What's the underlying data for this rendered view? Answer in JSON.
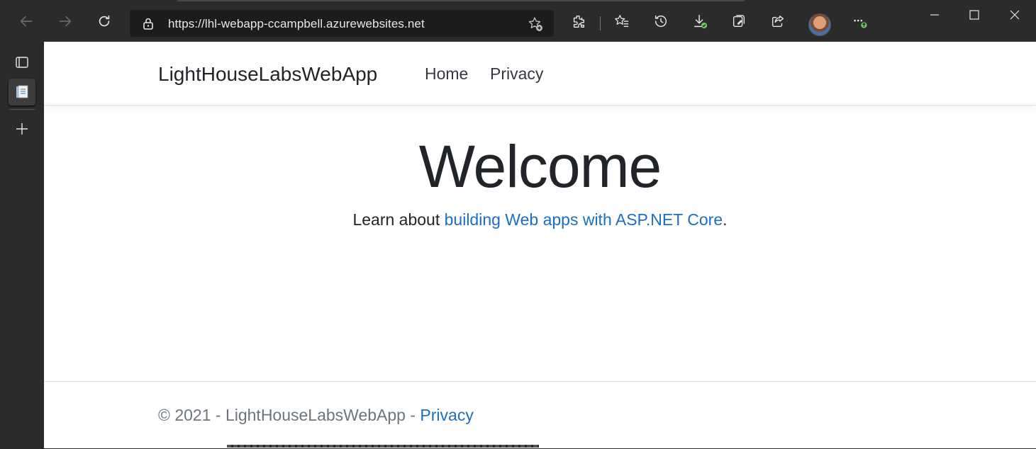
{
  "browser": {
    "url": "https://lhl-webapp-ccampbell.azurewebsites.net"
  },
  "site": {
    "brand": "LightHouseLabsWebApp",
    "nav": [
      "Home",
      "Privacy"
    ],
    "heading": "Welcome",
    "learn_prefix": "Learn about ",
    "learn_link": "building Web apps with ASP.NET Core",
    "learn_suffix": ".",
    "footer_text": "© 2021 - LightHouseLabsWebApp - ",
    "footer_link": "Privacy"
  },
  "icons": {
    "toolbar": [
      "back-icon",
      "forward-icon",
      "refresh-icon",
      "lock-icon",
      "add-favorite-icon",
      "extensions-icon",
      "favorites-icon",
      "history-icon",
      "downloads-icon",
      "collections-icon",
      "share-icon",
      "profile-avatar",
      "more-icon"
    ],
    "sidebar": [
      "tab-actions-icon",
      "vertical-tab-page-icon",
      "new-tab-icon"
    ]
  },
  "colors": {
    "link": "#1b6ec2",
    "chrome": "#2b2b2b"
  }
}
